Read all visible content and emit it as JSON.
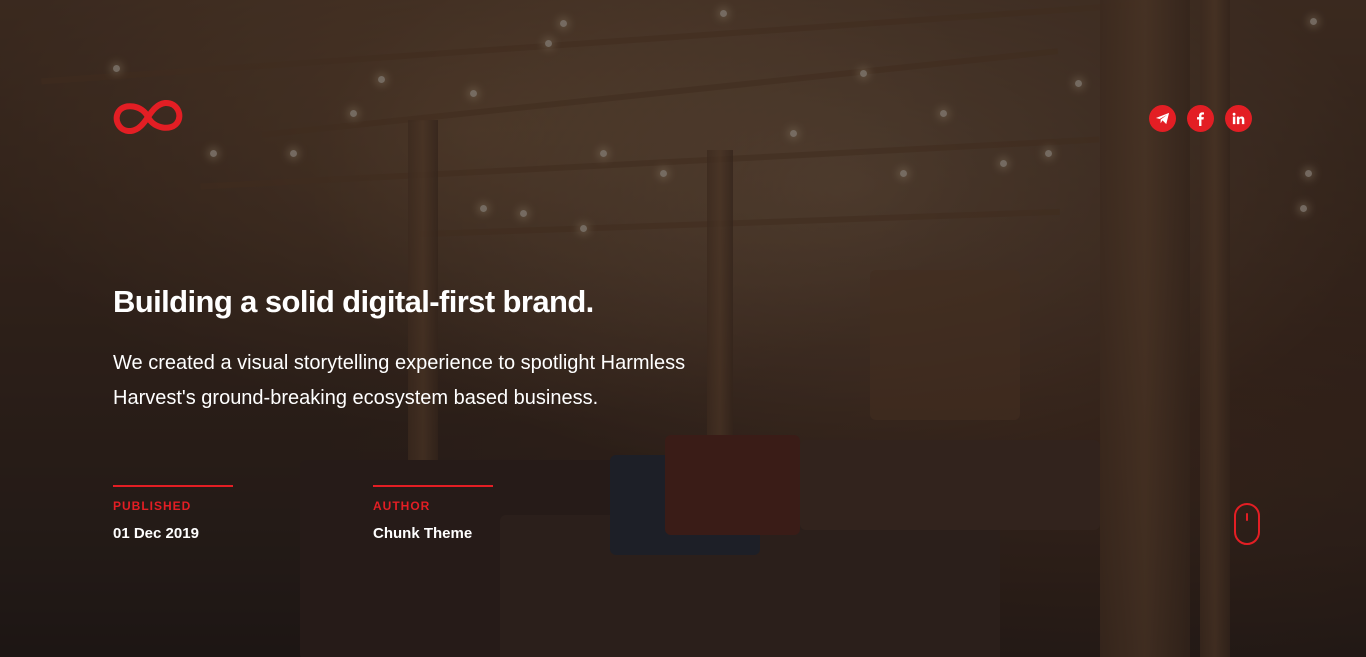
{
  "brand": {
    "logo_icon": "infinity-logo-icon",
    "accent_color": "#e31e24"
  },
  "social": [
    {
      "name": "telegram",
      "icon": "paper-plane-icon"
    },
    {
      "name": "facebook",
      "icon": "facebook-icon"
    },
    {
      "name": "linkedin",
      "icon": "linkedin-icon"
    }
  ],
  "hero": {
    "title": "Building a solid digital-first brand.",
    "description_line1": "We created a visual storytelling experience to spotlight Harmless",
    "description_line2": "Harvest's ground-breaking ecosystem based business."
  },
  "meta": {
    "published_label": "PUBLISHED",
    "published_value": "01 Dec 2019",
    "author_label": "AUTHOR",
    "author_value": "Chunk Theme"
  },
  "scroll_indicator": {
    "icon": "mouse-scroll-icon"
  }
}
